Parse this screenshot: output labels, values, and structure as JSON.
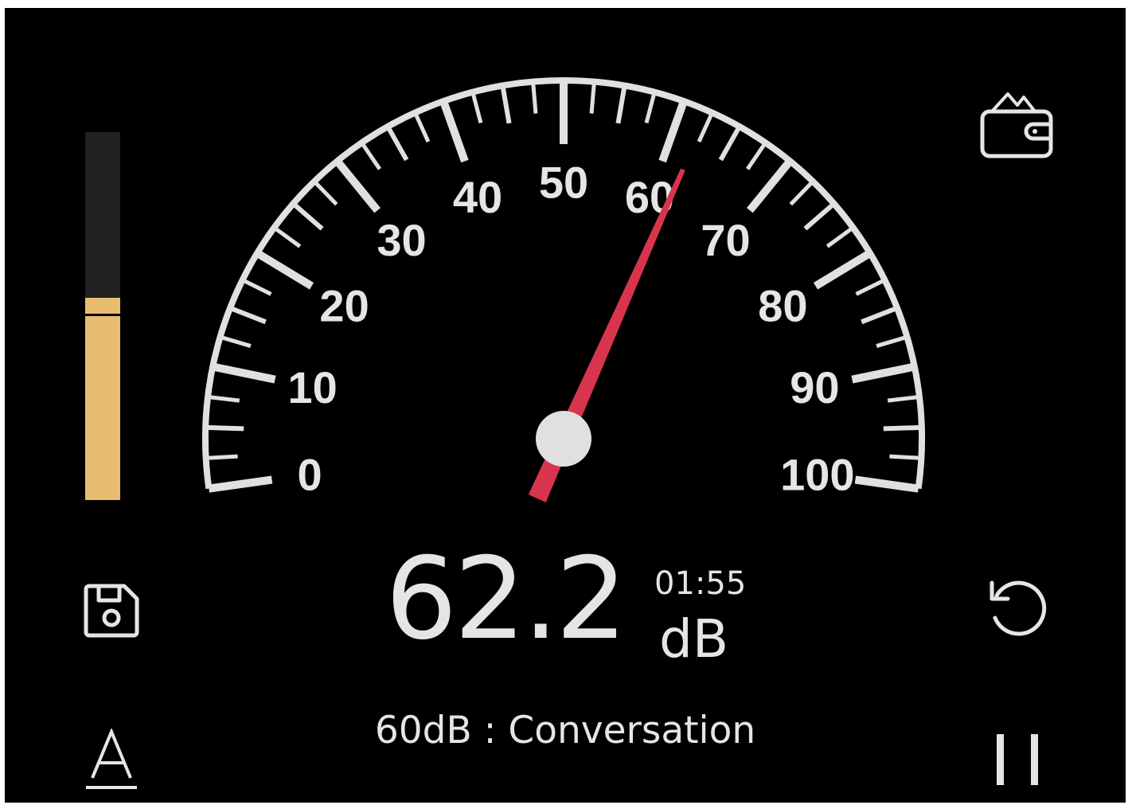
{
  "gauge": {
    "min": 0,
    "max": 100,
    "major_step": 10,
    "minor_step": 5,
    "tick_labels": [
      "0",
      "10",
      "20",
      "30",
      "40",
      "50",
      "60",
      "70",
      "80",
      "90",
      "100"
    ],
    "needle_value": 62.2,
    "needle_color": "#d9344d",
    "dial_color": "#e0e0e0"
  },
  "level_meter": {
    "level": 0.55,
    "peak": 0.5,
    "fill_color": "#e8bd72",
    "track_color": "#222222"
  },
  "reading": {
    "value": "62.2",
    "timer": "01:55",
    "unit": "dB"
  },
  "status": {
    "description": "60dB : Conversation"
  },
  "buttons": {
    "wallet_icon": "wallet-icon",
    "save_icon": "floppy-disk-icon",
    "reset_icon": "reset-icon",
    "weighting_icon": "a-weighting-icon",
    "pause_icon": "pause-icon"
  },
  "colors": {
    "background": "#000000",
    "foreground": "#e5e5e5",
    "accent": "#d9344d"
  }
}
